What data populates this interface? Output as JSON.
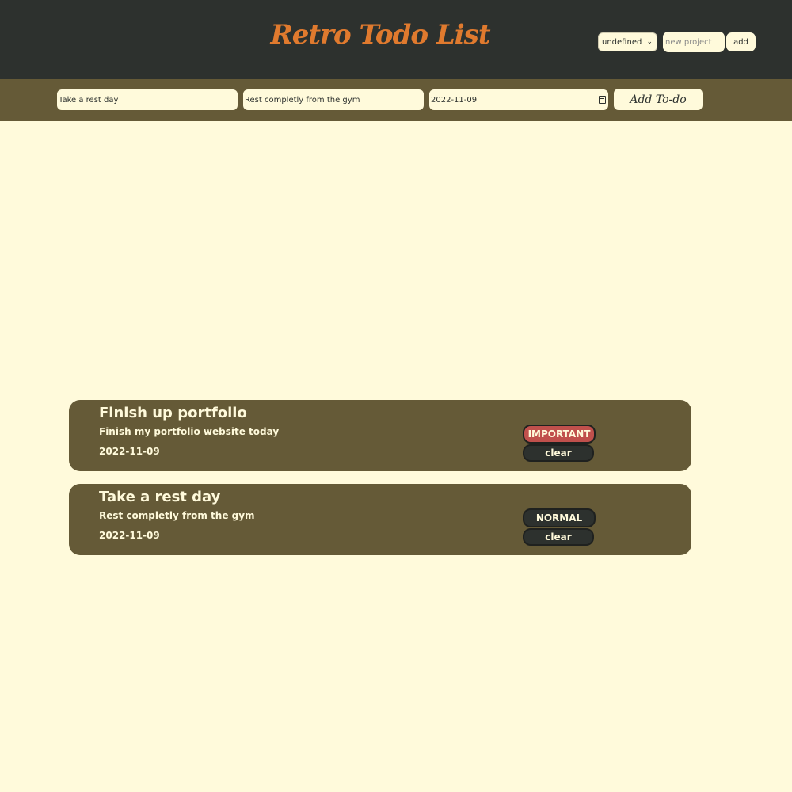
{
  "header": {
    "title": "Retro Todo List",
    "project_select_value": "undefined",
    "new_project_placeholder": "new project",
    "add_label": "add"
  },
  "form": {
    "title_value": "Take a rest day",
    "description_value": "Rest completly from the gym",
    "date_value": "2022-11-09",
    "add_todo_label": "Add To-do"
  },
  "todos": [
    {
      "title": "Finish up portfolio",
      "description": "Finish my portfolio website today",
      "date": "2022-11-09",
      "priority": "IMPORTANT",
      "clear_label": "clear"
    },
    {
      "title": "Take a rest day",
      "description": "Rest completly from the gym",
      "date": "2022-11-09",
      "priority": "NORMAL",
      "clear_label": "clear"
    }
  ],
  "colors": {
    "background": "#fffadb",
    "header": "#2d312e",
    "accent": "#e07a2e",
    "form_bar": "#655a37",
    "card": "#655a37",
    "important": "#c0504c",
    "normal": "#2d312e"
  },
  "icons": {
    "date_picker": "calendar-icon",
    "select": "chevron-down-icon"
  }
}
